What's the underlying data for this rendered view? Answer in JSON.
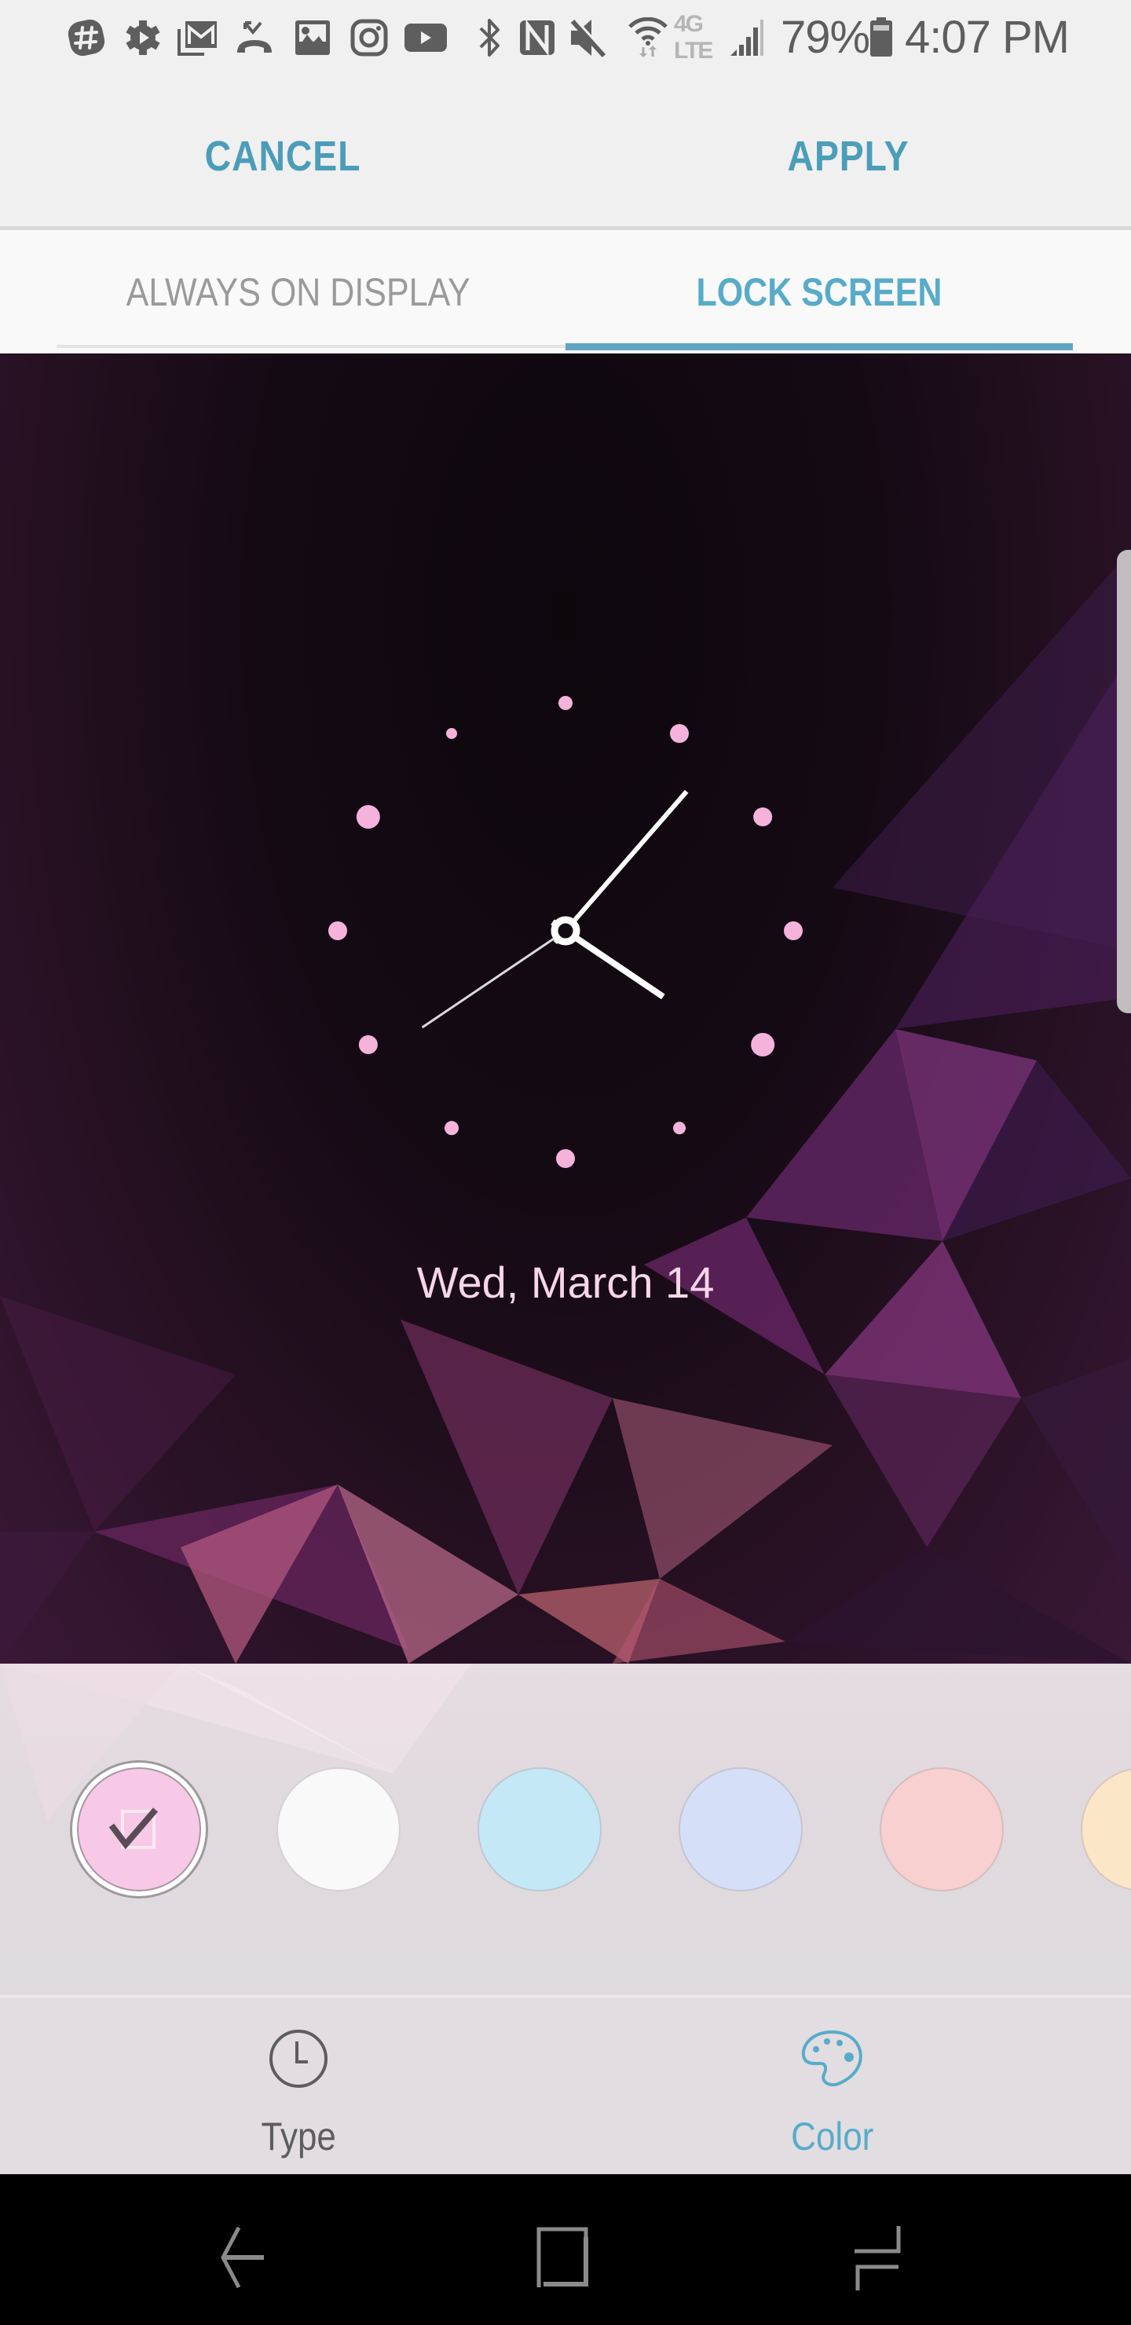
{
  "status_bar": {
    "notification_icons": [
      "slack-icon",
      "settings-play-icon",
      "gmail-icon",
      "missed-call-icon",
      "gallery-icon",
      "instagram-icon",
      "youtube-icon"
    ],
    "system_icons": [
      "bluetooth-icon",
      "nfc-icon",
      "mute-icon",
      "wifi-icon",
      "4g-lte-icon",
      "signal-icon",
      "battery-icon"
    ],
    "network_label": "4G LTE",
    "battery": "79%",
    "time": "4:07 PM"
  },
  "action_bar": {
    "cancel_label": "CANCEL",
    "apply_label": "APPLY"
  },
  "tabs": [
    {
      "label": "ALWAYS ON DISPLAY",
      "active": false
    },
    {
      "label": "LOCK SCREEN",
      "active": true
    }
  ],
  "preview": {
    "clock_style": "analog",
    "clock_time": {
      "hour": 4,
      "minute": 7,
      "second": 41
    },
    "date": "Wed, March 14",
    "dot_color": "#f5b3dc",
    "hand_color": "#ffffff"
  },
  "color_picker": {
    "selected_index": 0,
    "swatches": [
      {
        "name": "pink",
        "color": "#f7c9e6",
        "selected": true
      },
      {
        "name": "white",
        "color": "#f9f9f9",
        "selected": false
      },
      {
        "name": "light-blue",
        "color": "#c5e8f6",
        "selected": false
      },
      {
        "name": "periwinkle",
        "color": "#d5e0f8",
        "selected": false
      },
      {
        "name": "light-red",
        "color": "#f8d0d0",
        "selected": false
      },
      {
        "name": "cream",
        "color": "#fbe6c8",
        "selected": false
      }
    ]
  },
  "bottom_tabs": [
    {
      "label": "Type",
      "icon": "clock-icon",
      "active": false
    },
    {
      "label": "Color",
      "icon": "palette-icon",
      "active": true
    }
  ],
  "nav_bar": {
    "buttons": [
      "back",
      "home",
      "recents"
    ]
  },
  "colors": {
    "accent": "#4c9db9",
    "tab_active": "#58abc9",
    "tab_inactive": "#9a9a9a",
    "status_icon": "#5e5e5e"
  }
}
